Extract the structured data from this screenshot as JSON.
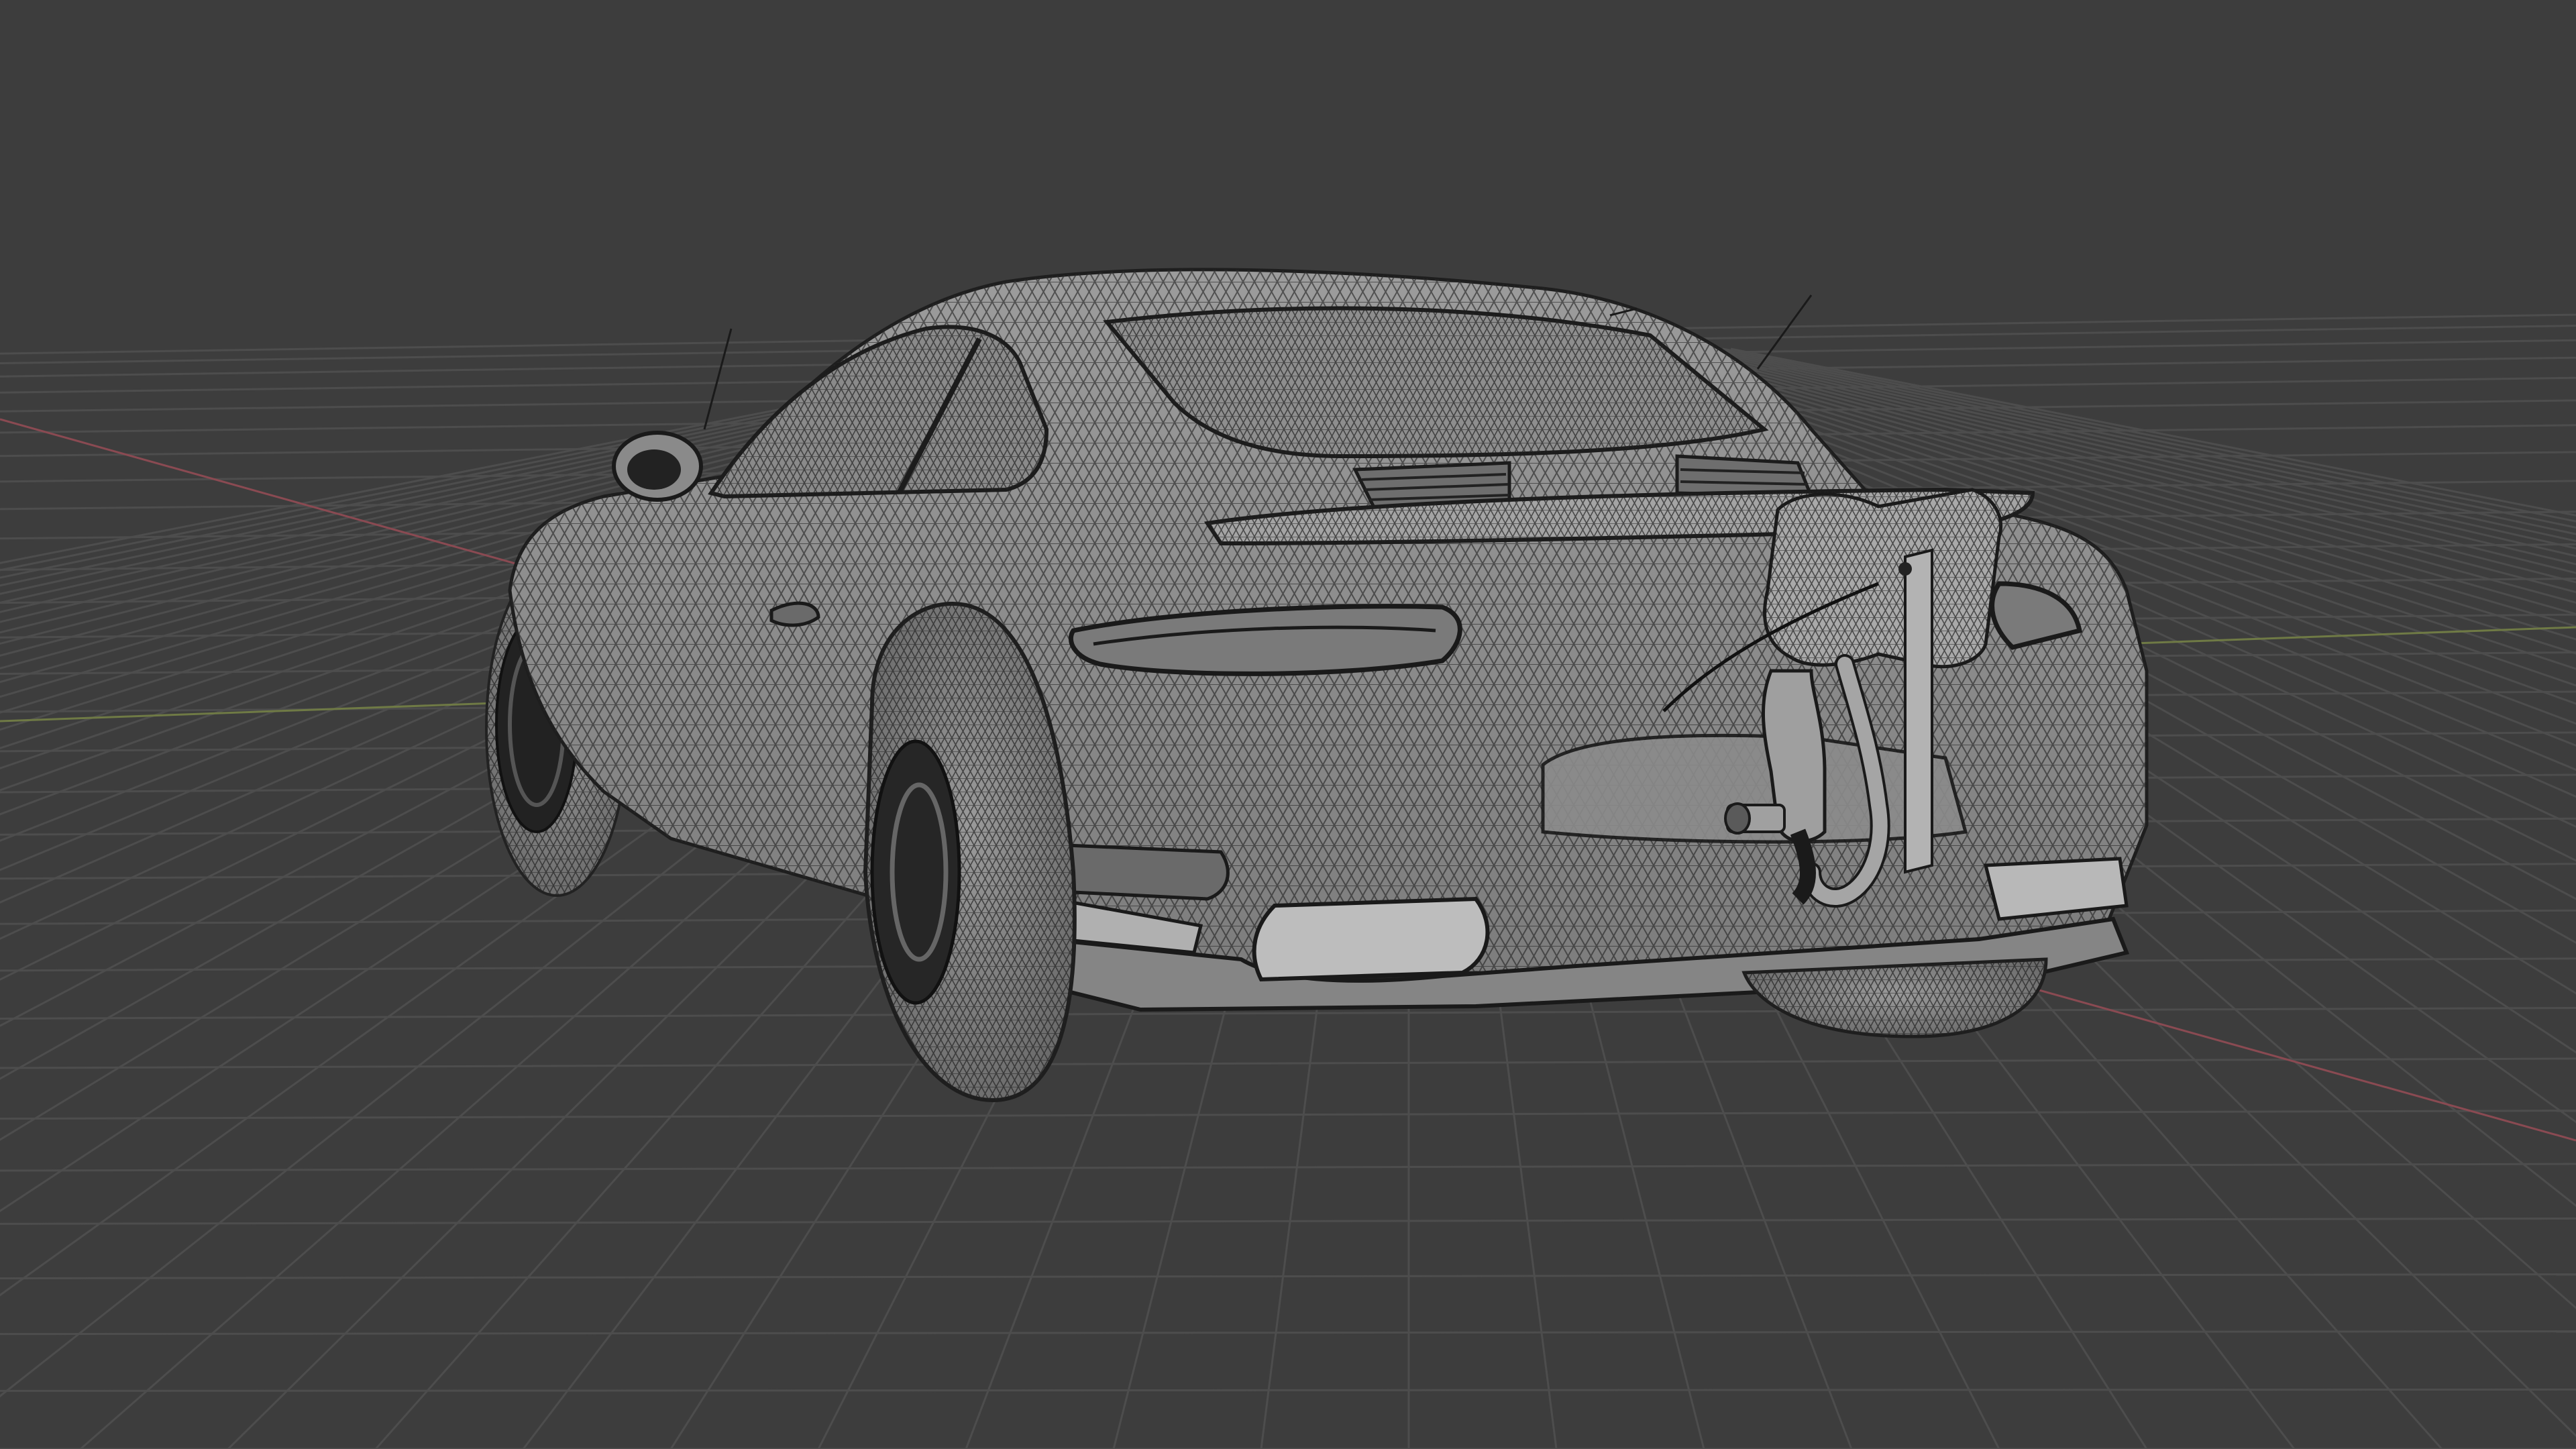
{
  "viewport": {
    "mode": "wireframe",
    "view": "perspective",
    "background_color": "#3d3d3d",
    "grid_color": "#4d4d4d",
    "x_axis_color": "#8a4a52",
    "y_axis_color": "#6f7a45",
    "wire_color": "#1e1e1e",
    "surface_color": "#8d8d8d",
    "highlight_color": "#b5b5b5"
  },
  "objects": [
    {
      "name": "sports-car-body",
      "type": "mesh"
    },
    {
      "name": "rear-spoiler",
      "type": "mesh"
    },
    {
      "name": "rear-left-wheel",
      "type": "mesh"
    },
    {
      "name": "rear-right-wheel",
      "type": "mesh"
    },
    {
      "name": "front-left-wheel",
      "type": "mesh"
    },
    {
      "name": "side-mirror",
      "type": "mesh"
    },
    {
      "name": "exhaust-attachment",
      "type": "mesh"
    }
  ]
}
